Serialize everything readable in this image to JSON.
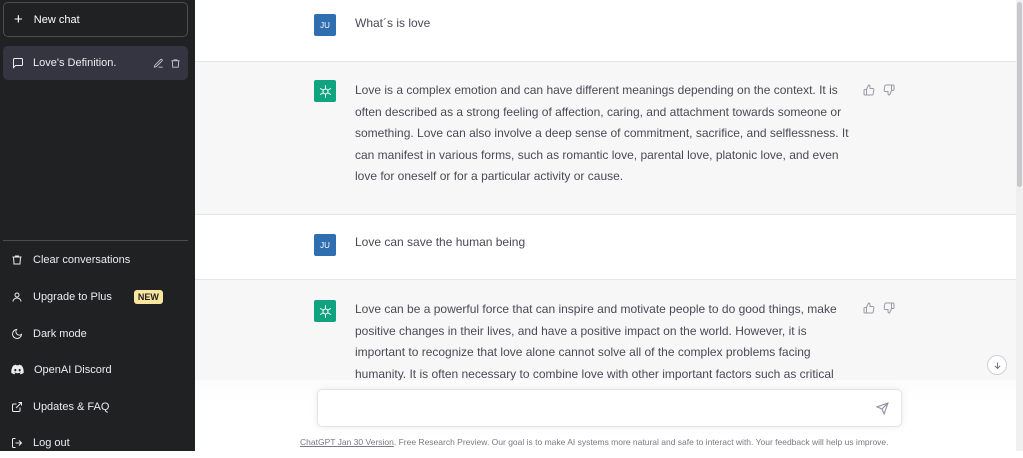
{
  "sidebar": {
    "new_chat_label": "New chat",
    "conversation": {
      "label": "Love's Definition."
    },
    "menu": [
      {
        "label": "Clear conversations",
        "icon": "trash-icon"
      },
      {
        "label": "Upgrade to Plus",
        "icon": "user-icon",
        "badge": "NEW"
      },
      {
        "label": "Dark mode",
        "icon": "moon-icon"
      },
      {
        "label": "OpenAI Discord",
        "icon": "discord-icon"
      },
      {
        "label": "Updates & FAQ",
        "icon": "external-link-icon"
      },
      {
        "label": "Log out",
        "icon": "logout-icon"
      }
    ]
  },
  "messages": [
    {
      "role": "user",
      "avatar": "JU",
      "text": "What´s is love"
    },
    {
      "role": "assistant",
      "text": "Love is a complex emotion and can have different meanings depending on the context. It is often described as a strong feeling of affection, caring, and attachment towards someone or something. Love can also involve a deep sense of commitment, sacrifice, and selflessness. It can manifest in various forms, such as romantic love, parental love, platonic love, and even love for oneself or for a particular activity or cause."
    },
    {
      "role": "user",
      "avatar": "JU",
      "text": "Love can save the human being"
    },
    {
      "role": "assistant",
      "text": "Love can be a powerful force that can inspire and motivate people to do good things, make positive changes in their lives, and have a positive impact on the world. However, it is important to recognize that love alone cannot solve all of the complex problems facing humanity. It is often necessary to combine love with other important factors such as critical"
    }
  ],
  "composer": {
    "value": "",
    "placeholder": ""
  },
  "footer": {
    "version_link": "ChatGPT Jan 30 Version",
    "text": ". Free Research Preview. Our goal is to make AI systems more natural and safe to interact with. Your feedback will help us improve."
  },
  "colors": {
    "sidebar_bg": "#202123",
    "selected_item_bg": "#343541",
    "assistant_row_bg": "#f7f7f8",
    "assistant_avatar": "#10a37f",
    "user_avatar": "#2f6fb0",
    "badge_bg": "#fae69e"
  }
}
